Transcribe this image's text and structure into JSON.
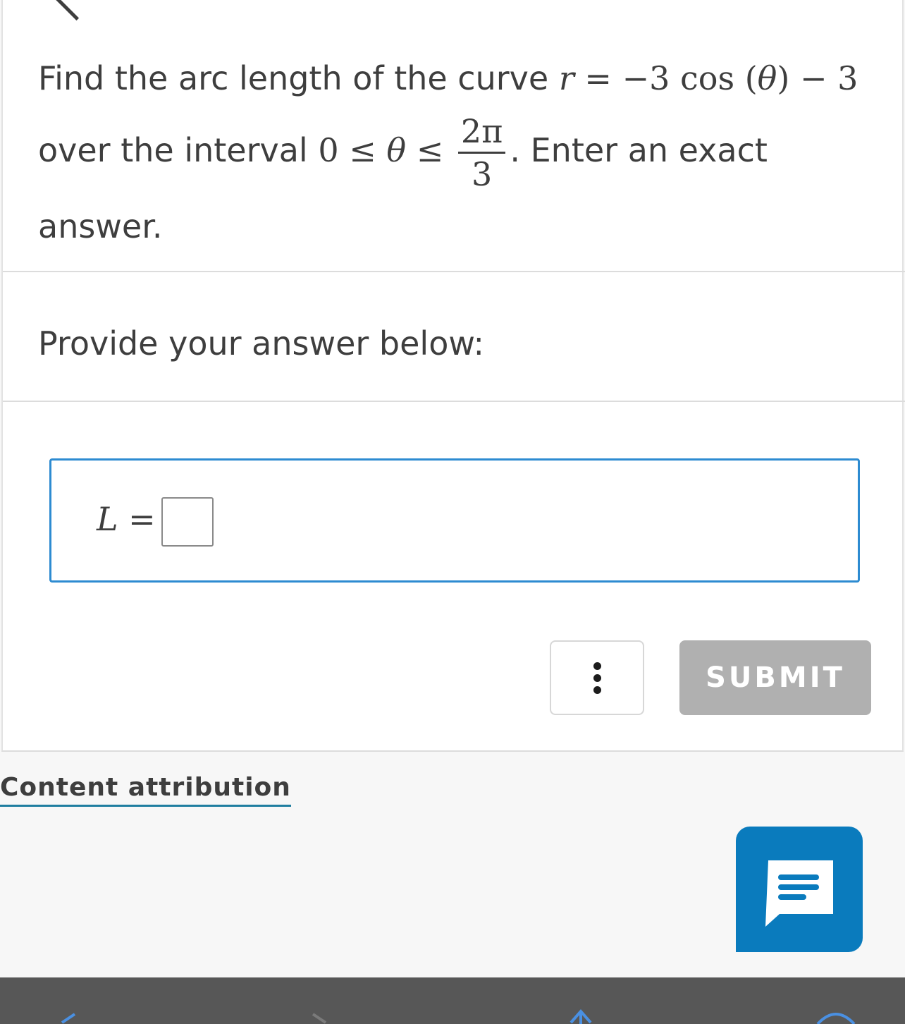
{
  "question": {
    "text_1": "Find the arc length of the curve ",
    "math_r": "r",
    "math_eq": " = −3 cos (",
    "math_theta": "θ",
    "math_tail": ") − 3",
    "text_2": "over the interval ",
    "interval_start": "0 ≤ ",
    "interval_theta": "θ",
    "interval_le": " ≤",
    "frac_num": "2π",
    "frac_den": "3",
    "text_3": ". Enter an exact",
    "text_4": "answer."
  },
  "prompt": "Provide your answer below:",
  "answer": {
    "label_var": "L",
    "label_eq": " =",
    "value": ""
  },
  "buttons": {
    "submit": "SUBMIT"
  },
  "footer": {
    "attribution": "Content attribution"
  },
  "colors": {
    "accent_blue": "#2d8bd1",
    "chat_blue": "#0a7bbd",
    "submit_gray": "#b0b0b0"
  },
  "icons": [
    "back-chevron-icon",
    "more-options-icon",
    "chat-icon",
    "nav-back-icon",
    "nav-forward-icon",
    "share-icon",
    "tabs-icon"
  ]
}
